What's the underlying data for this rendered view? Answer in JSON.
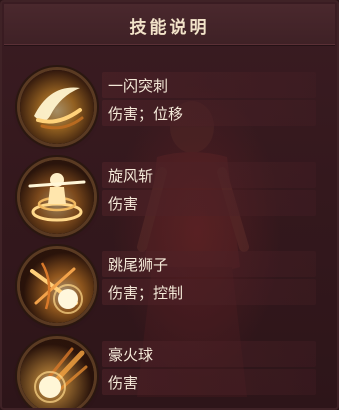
{
  "title": "技能说明",
  "skills": [
    {
      "name": "一闪突刺",
      "tags": "伤害；位移",
      "icon": "slash-icon"
    },
    {
      "name": "旋风斩",
      "tags": "伤害",
      "icon": "whirlwind-icon"
    },
    {
      "name": "跳尾狮子",
      "tags": "伤害；控制",
      "icon": "lion-leap-icon"
    },
    {
      "name": "豪火球",
      "tags": "伤害",
      "icon": "fireball-icon"
    }
  ],
  "colors": {
    "panel_bg": "#34181d",
    "title_text": "#f2e3c9",
    "text": "#f4e9d8",
    "icon_ring": "#5a3a22"
  }
}
